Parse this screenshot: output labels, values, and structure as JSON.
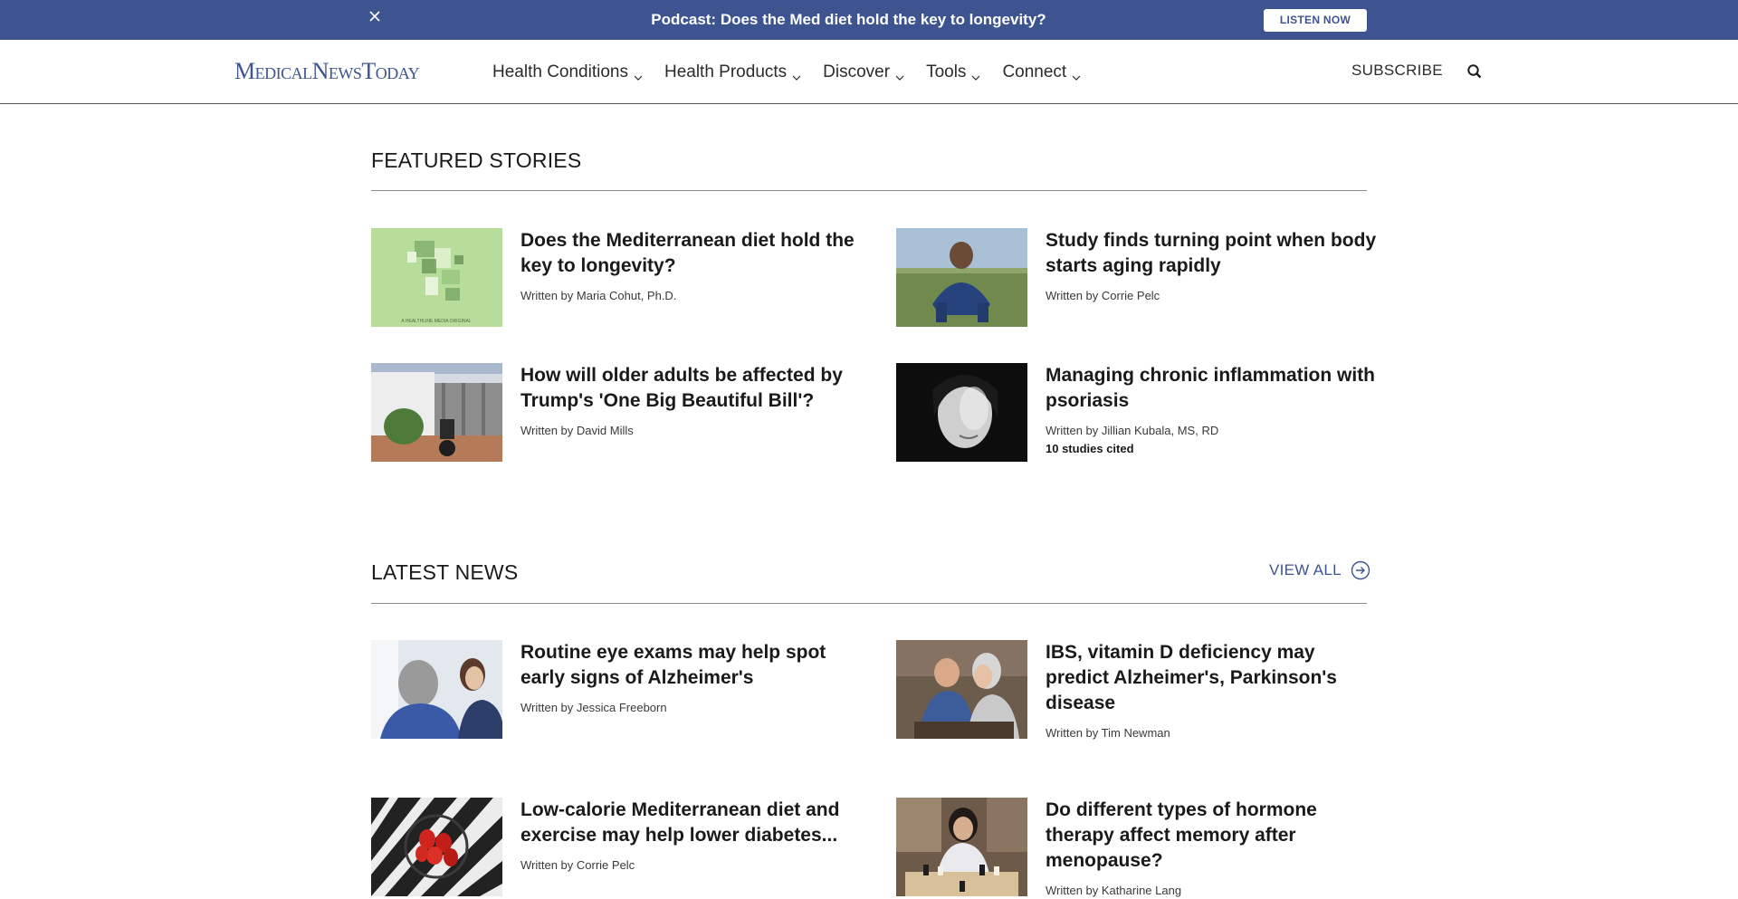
{
  "banner": {
    "text": "Podcast: Does the Med diet hold the key to longevity?",
    "cta": "LISTEN NOW",
    "close_icon": "close-icon"
  },
  "nav": {
    "logo": "MedicalNewsToday",
    "items": [
      {
        "label": "Health Conditions"
      },
      {
        "label": "Health Products"
      },
      {
        "label": "Discover"
      },
      {
        "label": "Tools"
      },
      {
        "label": "Connect"
      }
    ],
    "subscribe": "SUBSCRIBE",
    "search_icon": "search-icon"
  },
  "featured": {
    "title": "FEATURED STORIES",
    "stories": [
      {
        "title": "Does the Mediterranean diet hold the key to longevity?",
        "author": "Written by Maria Cohut, Ph.D.",
        "image": "podcast-art-image",
        "image_caption": "A HEALTHLINE MEDIA ORIGINAL"
      },
      {
        "title": "Study finds turning point when body starts aging rapidly",
        "author": "Written by Corrie Pelc",
        "image": "runner-image"
      },
      {
        "title": "How will older adults be affected by Trump's 'One Big Beautiful Bill'?",
        "author": "Written by David Mills",
        "image": "wheelchair-image"
      },
      {
        "title": "Managing chronic inflammation with psoriasis",
        "author": "Written by Jillian Kubala, MS, RD",
        "cited": "10 studies cited",
        "image": "portrait-image"
      }
    ]
  },
  "latest": {
    "title": "LATEST NEWS",
    "view_all": "VIEW ALL",
    "stories": [
      {
        "title": "Routine eye exams may help spot early signs of Alzheimer's",
        "author": "Written by Jessica Freeborn",
        "image": "eye-exam-image"
      },
      {
        "title": "IBS, vitamin D deficiency may predict Alzheimer's, Parkinson's disease",
        "author": "Written by Tim Newman",
        "image": "elderly-couple-image"
      },
      {
        "title": "Low-calorie Mediterranean diet and exercise may help lower diabetes...",
        "author": "Written by Corrie Pelc",
        "image": "strawberries-image"
      },
      {
        "title": "Do different types of hormone therapy affect memory after menopause?",
        "author": "Written by Katharine Lang",
        "image": "chess-image"
      }
    ]
  },
  "colors": {
    "brand": "#3e5490",
    "text": "#1a1a1a"
  }
}
